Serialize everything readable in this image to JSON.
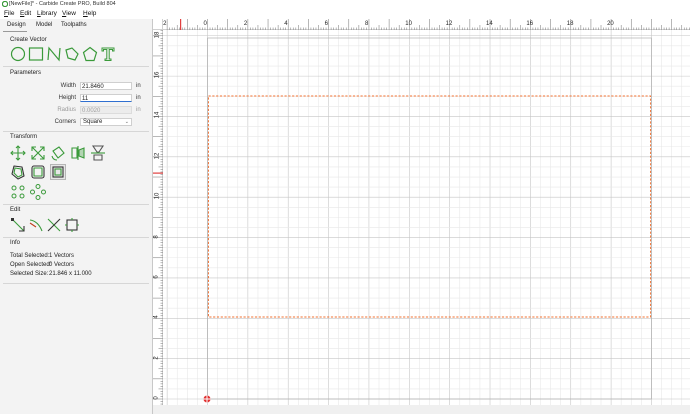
{
  "window": {
    "title": "[NewFile]* - Carbide Create PRO, Build 804"
  },
  "menu": {
    "items": [
      "File",
      "Edit",
      "Library",
      "View",
      "Help"
    ]
  },
  "tabs": [
    "Design",
    "Model",
    "Toolpaths"
  ],
  "create_vector": {
    "heading": "Create Vector",
    "tools": [
      "circle-icon",
      "rectangle-icon",
      "polyline-icon",
      "polygon-icon",
      "pentagon-icon",
      "text-icon"
    ]
  },
  "parameters": {
    "heading": "Parameters",
    "width": {
      "label": "Width",
      "value": "21.8460",
      "unit": "in"
    },
    "height": {
      "label": "Height",
      "value": "11",
      "unit": "in"
    },
    "radius": {
      "label": "Radius",
      "value": "0.0020",
      "unit": "in"
    },
    "corners": {
      "label": "Corners",
      "value": "Square"
    }
  },
  "transform": {
    "heading": "Transform",
    "tools": [
      "move-icon",
      "scale-icon",
      "rotate-icon",
      "mirror-icon",
      "offset-icon",
      "fillet-icon",
      "boundary-icon",
      "align-icon",
      "array-icon"
    ]
  },
  "edit": {
    "heading": "Edit",
    "tools": [
      "node-edit-icon",
      "trim-icon",
      "cut-icon",
      "join-icon"
    ]
  },
  "info": {
    "heading": "Info",
    "total_selected": {
      "label": "Total Selected:",
      "value": "1 Vectors"
    },
    "open_selected": {
      "label": "Open Selected:",
      "value": "0 Vectors"
    },
    "selected_size": {
      "label": "Selected Size:",
      "value": "21.846 x 11.000"
    }
  },
  "rulers": {
    "x_labels": [
      "2",
      "0",
      "2",
      "4",
      "6",
      "8",
      "10",
      "12",
      "14",
      "16",
      "18",
      "20",
      "22"
    ],
    "y_labels": [
      "18",
      "16",
      "14",
      "12",
      "10",
      "8",
      "6",
      "4",
      "2",
      "0"
    ]
  },
  "colors": {
    "accent": "#3a9a3a",
    "selection": "#f07030",
    "grid_minor": "#e8e8e8",
    "grid_major": "#c6c6c6",
    "ruler_marker": "#e04040"
  }
}
